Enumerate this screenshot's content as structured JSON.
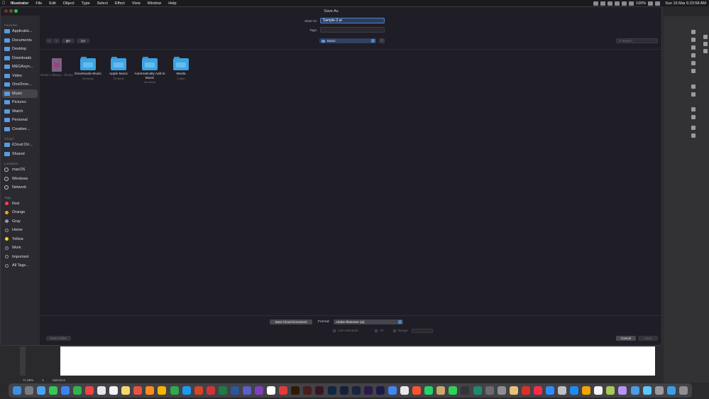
{
  "menubar": {
    "app_name": "Illustrator",
    "items": [
      "File",
      "Edit",
      "Object",
      "Type",
      "Select",
      "Effect",
      "View",
      "Window",
      "Help"
    ],
    "battery": "100%",
    "clock": "Sun 16 Mar 6:23:58 AM"
  },
  "dialog": {
    "title": "Save As",
    "save_as_label": "Save As:",
    "filename": "Sample-2.ai",
    "tags_label": "Tags:",
    "location": "Music",
    "search_placeholder": "Search"
  },
  "sidebar": {
    "favorites_header": "Favorites",
    "favorites": [
      {
        "label": "Applicatio...",
        "icon": "applications-icon"
      },
      {
        "label": "Documents",
        "icon": "document-icon"
      },
      {
        "label": "Desktop",
        "icon": "desktop-icon"
      },
      {
        "label": "Downloads",
        "icon": "download-icon"
      },
      {
        "label": "MEGAsyn...",
        "icon": "folder-icon"
      },
      {
        "label": "Video",
        "icon": "folder-icon"
      },
      {
        "label": "OneDrive...",
        "icon": "folder-icon"
      },
      {
        "label": "Music",
        "icon": "music-icon",
        "active": true
      },
      {
        "label": "Pictures",
        "icon": "folder-icon"
      },
      {
        "label": "Watch",
        "icon": "folder-icon"
      },
      {
        "label": "Personal",
        "icon": "folder-icon"
      },
      {
        "label": "Creative...",
        "icon": "folder-icon"
      }
    ],
    "icloud_header": "iCloud",
    "icloud": [
      {
        "label": "iCloud Dri...",
        "icon": "icloud-icon"
      },
      {
        "label": "Shared",
        "icon": "shared-icon"
      }
    ],
    "locations_header": "Locations",
    "locations": [
      {
        "label": "macOS",
        "icon": "disk-icon"
      },
      {
        "label": "Windows",
        "icon": "disk-icon"
      },
      {
        "label": "Network",
        "icon": "network-icon"
      }
    ],
    "tags_header": "Tags",
    "tags": [
      {
        "label": "Red",
        "color": "#ff453a"
      },
      {
        "label": "Orange",
        "color": "#ff9f0a"
      },
      {
        "label": "Gray",
        "color": "#98989d"
      },
      {
        "label": "Home",
        "color": "transparent"
      },
      {
        "label": "Yellow",
        "color": "#ffd60a"
      },
      {
        "label": "Work",
        "color": "transparent"
      },
      {
        "label": "Important",
        "color": "transparent"
      },
      {
        "label": "All Tags...",
        "color": "transparent"
      }
    ]
  },
  "files": [
    {
      "name": "Music Library....ibrary",
      "count": "",
      "type": "doc",
      "dim": true
    },
    {
      "name": "Downloads-Music",
      "count": "No items",
      "type": "folder"
    },
    {
      "name": "Apple Music",
      "count": "20 items",
      "type": "folder"
    },
    {
      "name": "Automatically Add to Music",
      "count": "No items",
      "type": "folder"
    },
    {
      "name": "Media",
      "count": "1 item",
      "type": "folder"
    }
  ],
  "options": {
    "cloud_button": "Save Cloud Document",
    "format_label": "Format:",
    "format_value": "Adobe Illustrator (ai)",
    "use_artboards": "Use Artboards",
    "all": "All",
    "range": "Range:"
  },
  "footer": {
    "new_folder": "New Folder",
    "cancel": "Cancel",
    "save": "Save"
  },
  "illustrator": {
    "zoom": "71.98%",
    "artboard_nav": "1",
    "tool": "Selection"
  },
  "colors": {
    "accent": "#4f84c9",
    "folder": "#3fa3e0",
    "dialog_bg": "#1f1d26"
  }
}
